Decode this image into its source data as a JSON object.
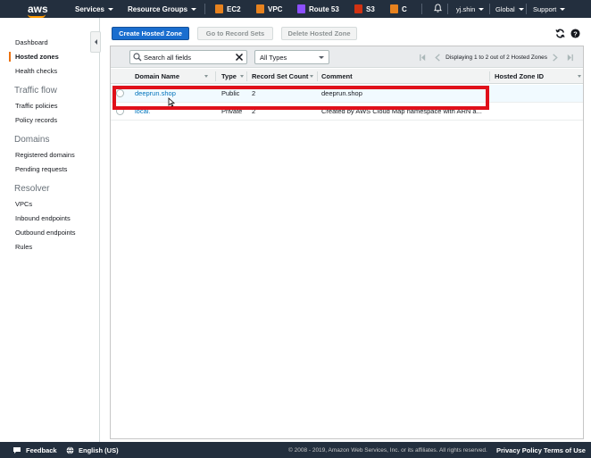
{
  "topnav": {
    "logo": "aws",
    "services": "Services",
    "resource_groups": "Resource Groups",
    "shortcuts": [
      {
        "label": "EC2",
        "color": "#e7821e"
      },
      {
        "label": "VPC",
        "color": "#e7821e"
      },
      {
        "label": "Route 53",
        "color": "#8c4fff"
      },
      {
        "label": "S3",
        "color": "#d13212"
      },
      {
        "label": "C",
        "color": "#e7821e"
      }
    ],
    "user": "yj.shin",
    "region": "Global",
    "support": "Support"
  },
  "sidebar": {
    "items": [
      {
        "label": "Dashboard",
        "active": false
      },
      {
        "label": "Hosted zones",
        "active": true
      },
      {
        "label": "Health checks",
        "active": false
      }
    ],
    "sections": [
      {
        "heading": "Traffic flow",
        "items": [
          "Traffic policies",
          "Policy records"
        ]
      },
      {
        "heading": "Domains",
        "items": [
          "Registered domains",
          "Pending requests"
        ]
      },
      {
        "heading": "Resolver",
        "items": [
          "VPCs",
          "Inbound endpoints",
          "Outbound endpoints",
          "Rules"
        ]
      }
    ]
  },
  "actions": {
    "create": "Create Hosted Zone",
    "goto": "Go to Record Sets",
    "delete": "Delete Hosted Zone"
  },
  "toolbar": {
    "search_placeholder": "Search all fields",
    "type_filter": "All Types",
    "pagination": "Displaying 1 to 2 out of 2 Hosted Zones"
  },
  "table": {
    "columns": [
      "Domain Name",
      "Type",
      "Record Set Count",
      "Comment",
      "Hosted Zone ID"
    ],
    "rows": [
      {
        "domain": "deeprun.shop",
        "type": "Public",
        "count": "2",
        "comment": "deeprun.shop",
        "zone_id": ""
      },
      {
        "domain": "local.",
        "type": "Private",
        "count": "2",
        "comment": "Created by AWS Cloud Map namespace with ARN a...",
        "zone_id": ""
      }
    ]
  },
  "footer": {
    "feedback": "Feedback",
    "language": "English (US)",
    "copyright": "© 2008 - 2019, Amazon Web Services, Inc. or its affiliates. All rights reserved.",
    "privacy": "Privacy Policy",
    "terms": "Terms of Use"
  },
  "colors": {
    "nav_bg": "#232f3e",
    "primary_button": "#1a6ecf",
    "active_accent": "#ec7211",
    "highlight_box": "#e0101a",
    "link": "#0073bb"
  }
}
